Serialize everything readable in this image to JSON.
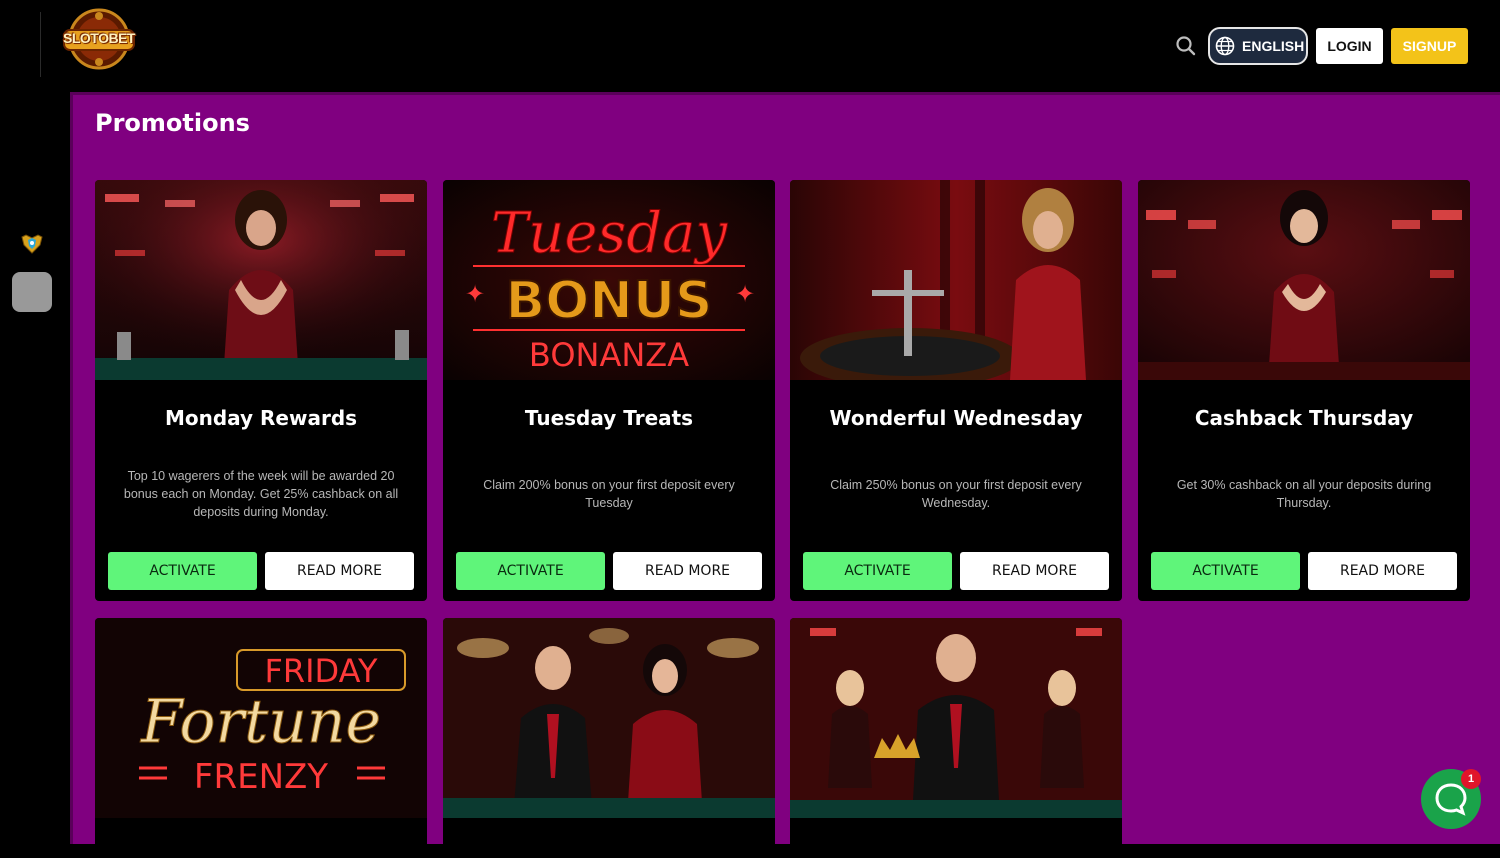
{
  "header": {
    "logo_text": "SLOTOBET",
    "search_icon": "search-icon",
    "language_label": "ENGLISH",
    "language_icon": "globe-icon",
    "login_label": "LOGIN",
    "signup_label": "SIGNUP"
  },
  "sidebar": {
    "items": [
      {
        "icon": "shield-badge-icon"
      },
      {
        "icon": "square-tile"
      }
    ]
  },
  "main": {
    "title": "Promotions",
    "cards": [
      {
        "title": "Monday Rewards",
        "description": "Top 10 wagerers of the week will be awarded 20 bonus each on Monday. Get 25% cashback on all deposits during Monday.",
        "activate_label": "ACTIVATE",
        "readmore_label": "READ MORE"
      },
      {
        "title": "Tuesday Treats",
        "description": "Claim 200% bonus on your first deposit every Tuesday",
        "activate_label": "ACTIVATE",
        "readmore_label": "READ MORE",
        "banner": {
          "script": "Tuesday",
          "big": "BONUS",
          "sub": "BONANZA"
        }
      },
      {
        "title": "Wonderful Wednesday",
        "description": "Claim 250% bonus on your first deposit every Wednesday.",
        "activate_label": "ACTIVATE",
        "readmore_label": "READ MORE"
      },
      {
        "title": "Cashback Thursday",
        "description": "Get 30% cashback on all your deposits during Thursday.",
        "activate_label": "ACTIVATE",
        "readmore_label": "READ MORE"
      },
      {
        "banner": {
          "top": "FRIDAY",
          "script": "Fortune",
          "sub": "FRENZY"
        }
      },
      {},
      {}
    ]
  },
  "chat": {
    "icon": "chat-icon",
    "unread_count": "1"
  },
  "colors": {
    "page_background": "#800080",
    "activate_button": "#5ff57a",
    "signup_button": "#f3c319",
    "chat_button": "#1aa34a"
  }
}
